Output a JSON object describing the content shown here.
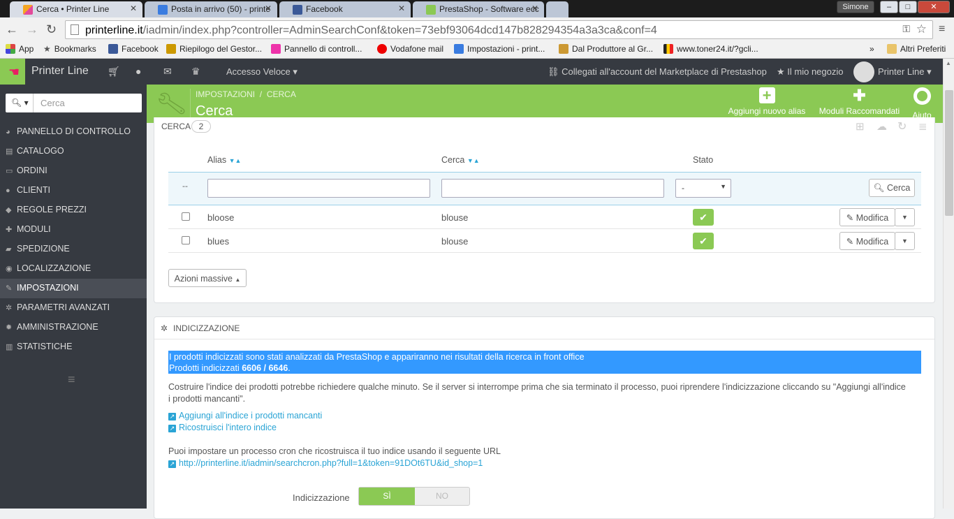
{
  "browser": {
    "tabs": [
      {
        "title": "Cerca • Printer Line",
        "color": "#f5a623"
      },
      {
        "title": "Posta in arrivo (50) - printe",
        "color": "#3a7ce0"
      },
      {
        "title": "Facebook",
        "color": "#3b5998"
      },
      {
        "title": "PrestaShop - Software ecc",
        "color": "#8bc954"
      }
    ],
    "user": "Simone",
    "window_min": "–",
    "window_max": "□",
    "window_close": "✕",
    "url_host": "printerline.it",
    "url_path": "/iadmin/index.php?controller=AdminSearchConf&token=73ebf93064dcd147b828294354a3a3ca&conf=4",
    "bookmarks": [
      {
        "label": "App",
        "color": "#d44"
      },
      {
        "label": "Bookmarks",
        "color": "#555"
      },
      {
        "label": "Facebook",
        "color": "#3b5998"
      },
      {
        "label": "Riepilogo del Gestor...",
        "color": "#c90"
      },
      {
        "label": "Pannello di controll...",
        "color": "#e3a"
      },
      {
        "label": "Vodafone mail",
        "color": "#e00"
      },
      {
        "label": "Impostazioni - print...",
        "color": "#3a7ce0"
      },
      {
        "label": "Dal Produttore al Gr...",
        "color": "#c93"
      },
      {
        "label": "www.toner24.it/?gcli...",
        "color": "#e50"
      }
    ],
    "bookmarks_more": "»",
    "other_bookmarks": "Altri Preferiti"
  },
  "header": {
    "shop_name": "Printer Line",
    "quick_access": "Accesso Veloce",
    "marketplace": "Collegati all'account del Marketplace di Prestashop",
    "my_shop": "Il mio negozio",
    "employee": "Printer Line"
  },
  "sidebar": {
    "search_placeholder": "Cerca",
    "items": [
      {
        "label": "PANNELLO DI CONTROLLO",
        "icon": "dashboard-icon",
        "glyph": "◕"
      },
      {
        "label": "CATALOGO",
        "icon": "book-icon",
        "glyph": "▤"
      },
      {
        "label": "ORDINI",
        "icon": "credit-card-icon",
        "glyph": "▭"
      },
      {
        "label": "CLIENTI",
        "icon": "users-icon",
        "glyph": "●"
      },
      {
        "label": "REGOLE PREZZI",
        "icon": "tag-icon",
        "glyph": "◆"
      },
      {
        "label": "MODULI",
        "icon": "puzzle-icon",
        "glyph": "✚"
      },
      {
        "label": "SPEDIZIONE",
        "icon": "truck-icon",
        "glyph": "▰"
      },
      {
        "label": "LOCALIZZAZIONE",
        "icon": "globe-icon",
        "glyph": "◉"
      },
      {
        "label": "IMPOSTAZIONI",
        "icon": "wrench-icon",
        "glyph": "✎"
      },
      {
        "label": "PARAMETRI AVANZATI",
        "icon": "cogs-icon",
        "glyph": "✲"
      },
      {
        "label": "AMMINISTRAZIONE",
        "icon": "cog-icon",
        "glyph": "✹"
      },
      {
        "label": "STATISTICHE",
        "icon": "bar-chart-icon",
        "glyph": "▥"
      }
    ],
    "collapse_icon": "≡"
  },
  "toolbar": {
    "breadcrumb_1": "IMPOSTAZIONI",
    "breadcrumb_sep": "/",
    "breadcrumb_2": "CERCA",
    "title": "Cerca",
    "btn_add_alias": "Aggiungi nuovo alias",
    "btn_modules": "Moduli Raccomandati",
    "btn_help": "Aiuto"
  },
  "alias_panel": {
    "heading": "CERCA",
    "count": "2",
    "col_alias": "Alias",
    "col_search": "Cerca",
    "col_status": "Stato",
    "filter_dash": "--",
    "status_filter": "-",
    "search_button": "Cerca",
    "rows": [
      {
        "alias": "bloose",
        "search": "blouse",
        "edit": "Modifica"
      },
      {
        "alias": "blues",
        "search": "blouse",
        "edit": "Modifica"
      }
    ],
    "bulk_actions": "Azioni massive"
  },
  "index_panel": {
    "heading": "INDICIZZAZIONE",
    "info_line1": "I prodotti indicizzati sono stati analizzati da PrestaShop e appariranno nei risultati della ricerca in front office",
    "info_line2_prefix": "Prodotti indicizzati",
    "info_line2_count": "6606 / 6646",
    "info_line2_suffix": ".",
    "desc_line1": "Costruire l'indice dei prodotti potrebbe richiedere qualche minuto. Se il server si interrompe prima che sia terminato il processo, puoi riprendere l'indicizzazione cliccando su \"Aggiungi all'indice",
    "desc_line2": "i prodotti mancanti\".",
    "link_add_missing": "Aggiungi all'indice i prodotti mancanti",
    "link_rebuild": "Ricostruisci l'intero indice",
    "cron_text": "Puoi impostare un processo cron che ricostruisca il tuo indice usando il seguente URL",
    "cron_url": "http://printerline.it/iadmin/searchcron.php?full=1&token=91DOt6TU&id_shop=1",
    "toggle_label": "Indicizzazione",
    "toggle_yes": "SÌ",
    "toggle_no": "NO"
  }
}
